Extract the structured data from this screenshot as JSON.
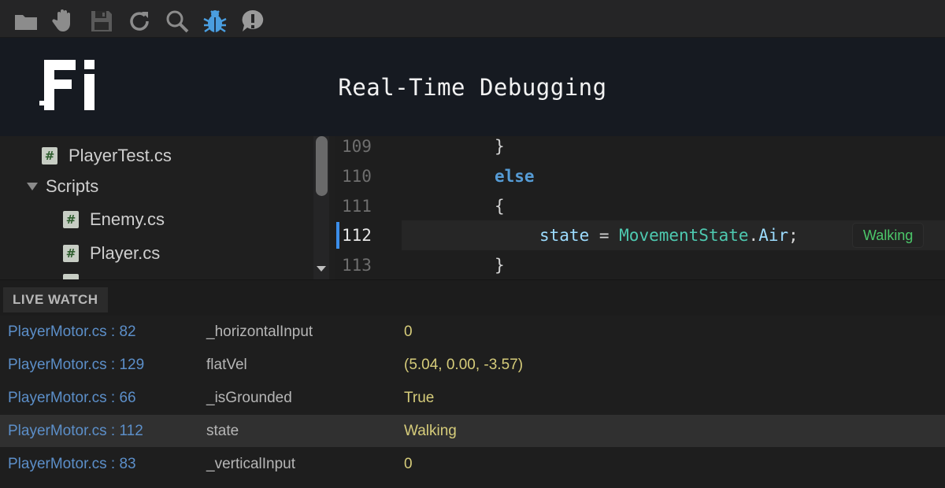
{
  "toolbar": {
    "buttons": [
      {
        "name": "folder-icon"
      },
      {
        "name": "hand-icon"
      },
      {
        "name": "save-icon"
      },
      {
        "name": "refresh-icon"
      },
      {
        "name": "search-icon"
      },
      {
        "name": "bug-icon",
        "color": "#4a9ee0"
      },
      {
        "name": "alert-icon"
      }
    ]
  },
  "banner": {
    "logo_text": "Fi",
    "title": "Real-Time Debugging"
  },
  "file_tree": {
    "items": [
      {
        "label": "PlayerTest.cs",
        "type": "file"
      },
      {
        "label": "Scripts",
        "type": "folder",
        "expanded": true
      },
      {
        "label": "Enemy.cs",
        "type": "file"
      },
      {
        "label": "Player.cs",
        "type": "file"
      }
    ],
    "file_glyph": "#"
  },
  "editor": {
    "line_numbers": [
      "109",
      "110",
      "111",
      "112",
      "113"
    ],
    "active_line": "112",
    "lines": {
      "l109": "}",
      "l110_kw": "else",
      "l111": "{",
      "l112_var": "state",
      "l112_eq": " = ",
      "l112_type": "MovementState",
      "l112_dot": ".",
      "l112_member": "Air",
      "l112_end": ";",
      "l113": "}"
    },
    "inline_value": "Walking",
    "inline_value_color": "#4cc86a"
  },
  "live_watch": {
    "title": "LIVE WATCH",
    "rows": [
      {
        "location": "PlayerMotor.cs : 82",
        "variable": "_horizontalInput",
        "value": "0"
      },
      {
        "location": "PlayerMotor.cs : 129",
        "variable": "flatVel",
        "value": "(5.04, 0.00, -3.57)"
      },
      {
        "location": "PlayerMotor.cs : 66",
        "variable": "_isGrounded",
        "value": "True"
      },
      {
        "location": "PlayerMotor.cs : 112",
        "variable": "state",
        "value": "Walking",
        "selected": true
      },
      {
        "location": "PlayerMotor.cs : 83",
        "variable": "_verticalInput",
        "value": "0"
      }
    ]
  },
  "colors": {
    "accent_blue": "#3b8eea",
    "watch_location": "#5c8fc9",
    "watch_value": "#d6cc7a"
  }
}
